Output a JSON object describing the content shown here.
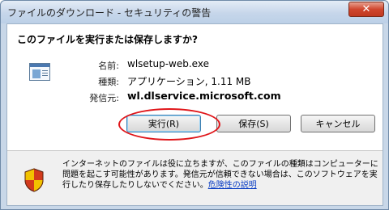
{
  "window": {
    "title": "ファイルのダウンロード - セキュリティの警告",
    "close_label": "✕"
  },
  "dialog": {
    "question": "このファイルを実行または保存しますか?",
    "file_icon": "application-window-icon",
    "fields": {
      "name_label": "名前:",
      "name_value": "wlsetup-web.exe",
      "type_label": "種類:",
      "type_value": "アプリケーション, 1.11 MB",
      "source_label": "発信元:",
      "source_value": "wl.dlservice.microsoft.com"
    },
    "buttons": {
      "run": "実行(R)",
      "save": "保存(S)",
      "cancel": "キャンセル"
    },
    "warning": {
      "icon": "security-shield-icon",
      "text": "インターネットのファイルは役に立ちますが、このファイルの種類はコンピューターに問題を起こす可能性があります。発信元が信頼できない場合は、このソフトウェアを実行したり保存したりしないでください。",
      "link": "危険性の説明"
    }
  },
  "colors": {
    "titlebar": "#c6d6ea",
    "close_button": "#d0462e",
    "highlight_ring": "#e0161a",
    "link": "#0b3ec4",
    "shield_yellow": "#f2c200",
    "shield_red": "#d23a1c"
  }
}
